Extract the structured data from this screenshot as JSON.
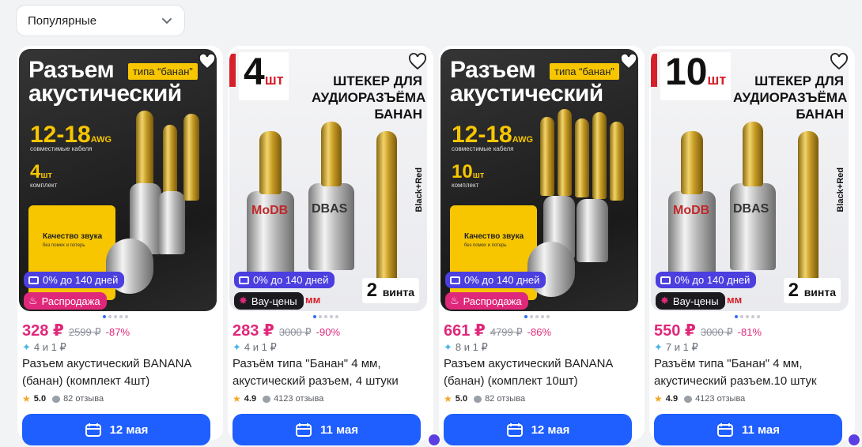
{
  "sort": {
    "label": "Популярные"
  },
  "colors": {
    "accent": "#1f5eff",
    "price": "#e0287a",
    "installment": "#4b3fe0",
    "sale": "#e0287a",
    "vau": "#1b1b1f"
  },
  "products": [
    {
      "image_text": {
        "line1": "Разъем",
        "line2": "акустический",
        "tag": "типа “банан”",
        "spec": "12-18",
        "spec_unit": "AWG",
        "spec_sub": "совместимые кабеля",
        "qty": "4",
        "qty_unit": "шт",
        "qty_sub": "комплект",
        "feature": "Качество звука",
        "feature_sub": "без помех и потерь"
      },
      "installment": "0% до 140 дней",
      "promo": "Распродажа",
      "price": "328 ₽",
      "old_price": "2599 ₽",
      "discount": "-87%",
      "bonus": "4 и 1 ₽",
      "title": "Разъем акустический BANANA (банан) (комплект 4шт)",
      "rating": "5.0",
      "reviews": "82 отзыва",
      "delivery": "12 мая"
    },
    {
      "image_text": {
        "num": "4",
        "num_unit": "шт",
        "head": "ШТЕКЕР ДЛЯ АУДИОРАЗЪЁМА БАНАН",
        "brand1": "MoDB",
        "brand2": "DBAS",
        "side": "Black+Red",
        "vint_num": "2",
        "vint": "винта",
        "mm": "мм"
      },
      "installment": "0% до 140 дней",
      "promo": "Вау-цены",
      "price": "283 ₽",
      "old_price": "3000 ₽",
      "discount": "-90%",
      "bonus": "4 и 1 ₽",
      "title": "Разъём типа \"Банан\" 4 мм, акустический разъем, 4 штуки",
      "rating": "4.9",
      "reviews": "4123 отзыва",
      "delivery": "11 мая"
    },
    {
      "image_text": {
        "line1": "Разъем",
        "line2": "акустический",
        "tag": "типа “банан”",
        "spec": "12-18",
        "spec_unit": "AWG",
        "spec_sub": "совместимые кабеля",
        "qty": "10",
        "qty_unit": "шт",
        "qty_sub": "комплект",
        "feature": "Качество звука",
        "feature_sub": "без помех и потерь"
      },
      "installment": "0% до 140 дней",
      "promo": "Распродажа",
      "price": "661 ₽",
      "old_price": "4799 ₽",
      "discount": "-86%",
      "bonus": "8 и 1 ₽",
      "title": "Разъем акустический BANANA (банан) (комплект 10шт)",
      "rating": "5.0",
      "reviews": "82 отзыва",
      "delivery": "12 мая"
    },
    {
      "image_text": {
        "num": "10",
        "num_unit": "шт",
        "head": "ШТЕКЕР ДЛЯ АУДИОРАЗЪЁМА БАНАН",
        "brand1": "MoDB",
        "brand2": "DBAS",
        "side": "Black+Red",
        "vint_num": "2",
        "vint": "винта",
        "mm": "мм"
      },
      "installment": "0% до 140 дней",
      "promo": "Вау-цены",
      "price": "550 ₽",
      "old_price": "3000 ₽",
      "discount": "-81%",
      "bonus": "7 и 1 ₽",
      "title": "Разъём типа \"Банан\" 4 мм, акустический разъем.10 штук",
      "rating": "4.9",
      "reviews": "4123 отзыва",
      "delivery": "11 мая"
    }
  ]
}
